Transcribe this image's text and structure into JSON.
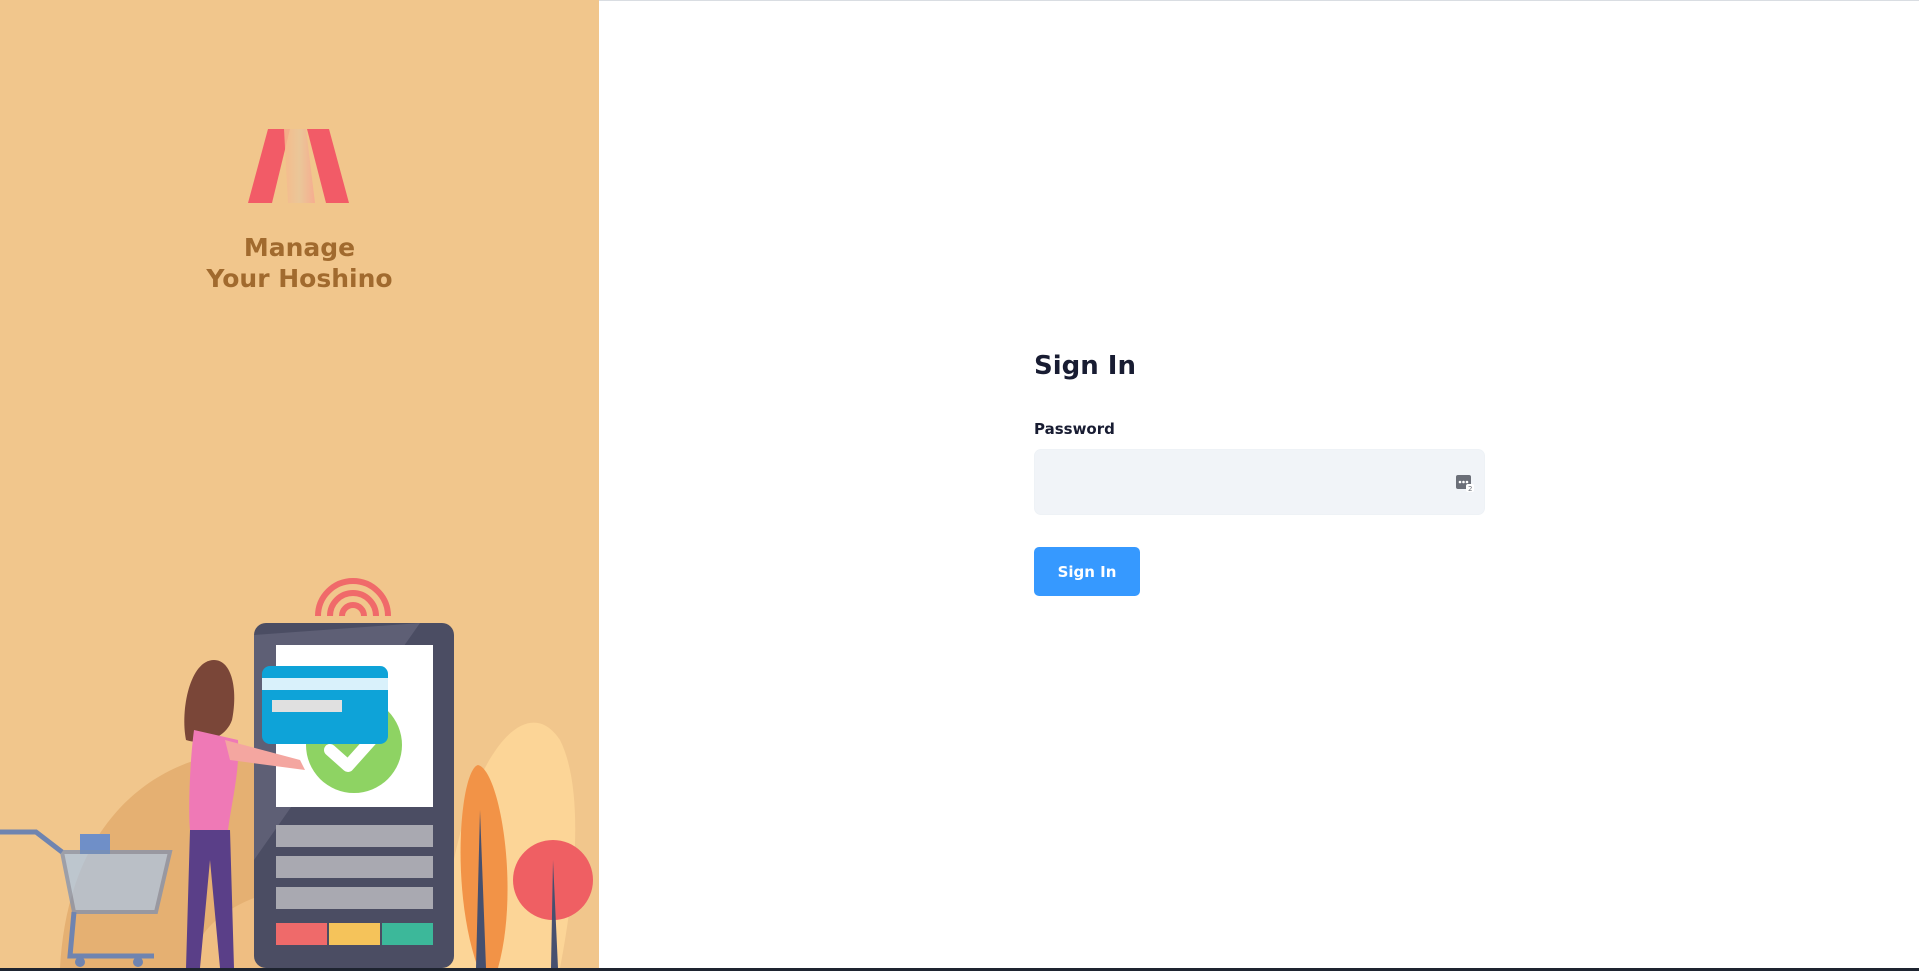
{
  "brand": {
    "logo_icon": "brand-m-logo-icon",
    "title_line1": "Manage",
    "title_line2": "Your Hoshino",
    "panel_color": "#f1c68c",
    "title_color": "#a16a2e"
  },
  "illustration": {
    "name": "self-checkout-kiosk-illustration"
  },
  "form": {
    "title": "Sign In",
    "password_label": "Password",
    "password_value": "",
    "password_placeholder": "",
    "password_icon": "password-manager-icon",
    "submit_label": "Sign In",
    "accent_color": "#3699ff"
  }
}
